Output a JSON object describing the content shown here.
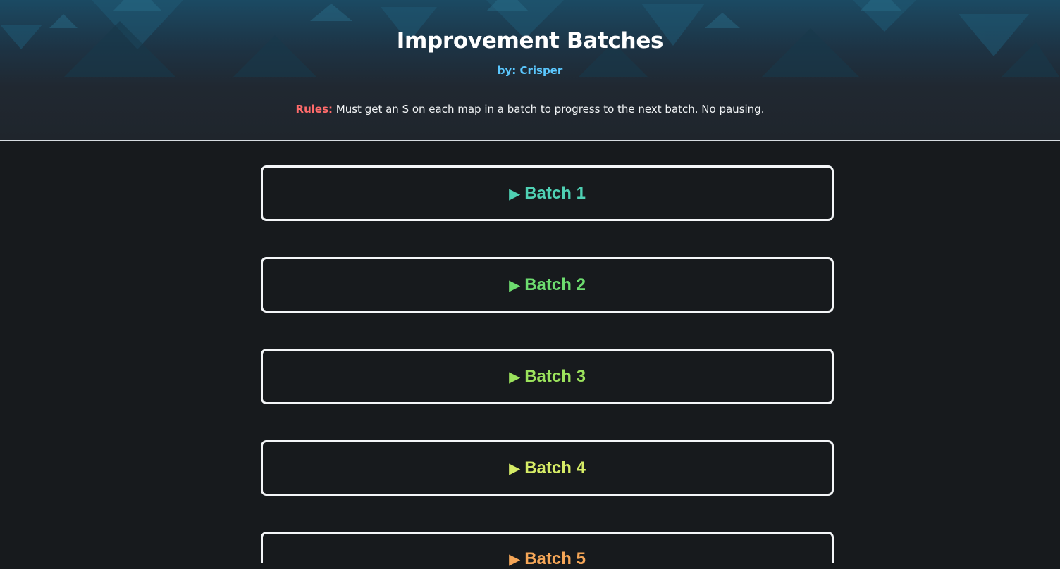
{
  "header": {
    "title": "Improvement Batches",
    "author": "by: Crisper",
    "rules_label": "Rules:",
    "rules_text": " Must get an S on each map in a batch to progress to the next batch. No pausing.",
    "colors": {
      "author": "#5bc8ff",
      "rules_label": "#ff6b6b"
    }
  },
  "batches": [
    {
      "arrow": "▶",
      "label": "Batch 1",
      "color": "#4fd1b4"
    },
    {
      "arrow": "▶",
      "label": "Batch 2",
      "color": "#6ddc6f"
    },
    {
      "arrow": "▶",
      "label": "Batch 3",
      "color": "#9be25c"
    },
    {
      "arrow": "▶",
      "label": "Batch 4",
      "color": "#d6ec66"
    },
    {
      "arrow": "▶",
      "label": "Batch 5",
      "color": "#f5a657"
    }
  ]
}
